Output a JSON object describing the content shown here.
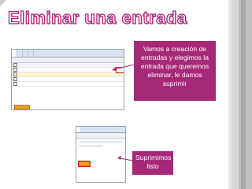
{
  "slide": {
    "title": "Eliminar  una entrada",
    "callout1": "Vamos a creación de entradas  y elegimos la entrada que queremos eliminar, le damos suprimir",
    "callout2": "Suprimimos listo"
  },
  "colors": {
    "accent": "#a62878",
    "title_outline": "#b0247c"
  },
  "icons": [
    "arrow-icon"
  ]
}
